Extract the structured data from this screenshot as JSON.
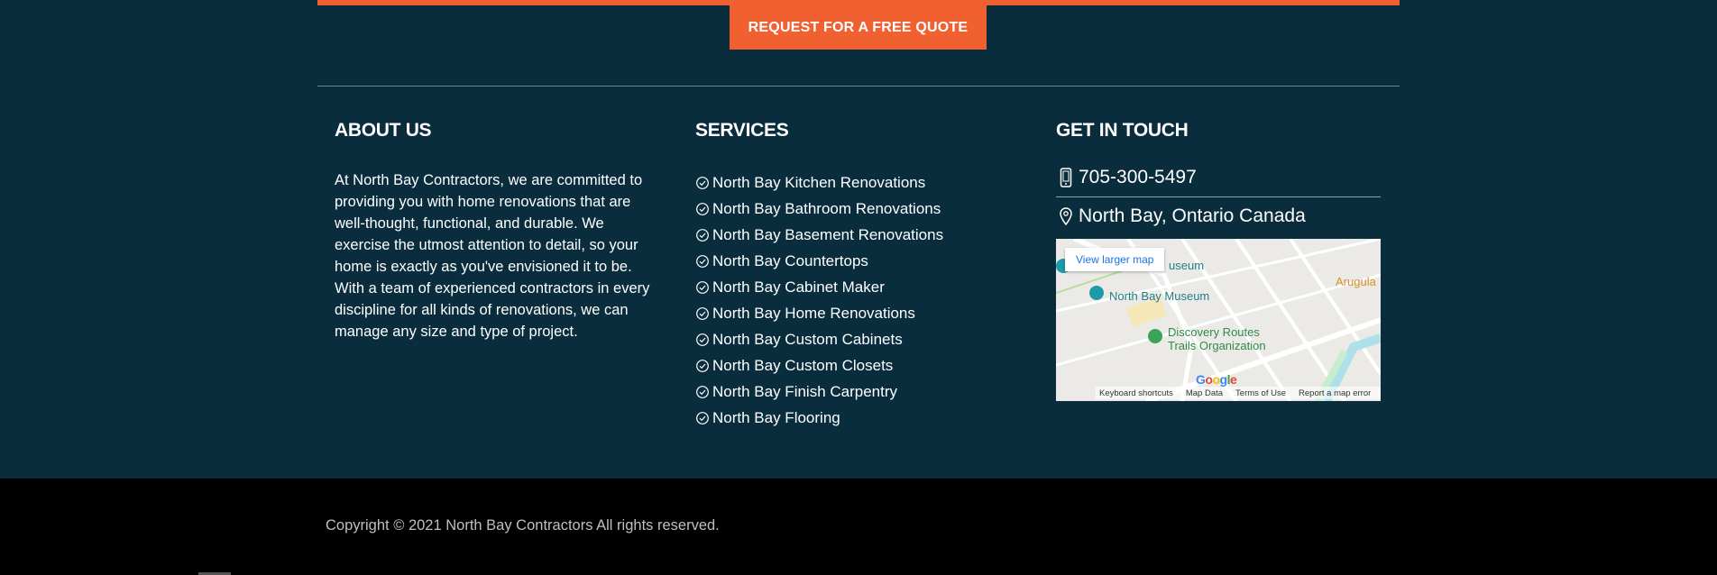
{
  "cta": {
    "quote_label": "REQUEST FOR A FREE QUOTE"
  },
  "about": {
    "title": "ABOUT US",
    "text": "At North Bay Contractors, we are committed to providing you with home renovations that are well-thought, functional, and durable. We exercise the utmost attention to detail, so your home is exactly as you've envisioned it to be. With a team of experienced contractors in every discipline for all kinds of renovations, we can manage any size and type of project."
  },
  "services": {
    "title": "SERVICES",
    "items": [
      "North Bay Kitchen Renovations",
      "North Bay Bathroom Renovations",
      "North Bay Basement Renovations",
      "North Bay Countertops",
      "North Bay Cabinet Maker",
      "North Bay Home Renovations",
      "North Bay Custom Cabinets",
      "North Bay Custom Closets",
      "North Bay Finish Carpentry",
      "North Bay Flooring"
    ]
  },
  "contact": {
    "title": "GET IN TOUCH",
    "phone": "705-300-5497",
    "location": "North Bay, Ontario Canada"
  },
  "map": {
    "view_larger": "View larger map",
    "labels": {
      "museum_partial": "useum",
      "museum": "North Bay Museum",
      "discovery_1": "Discovery Routes",
      "discovery_2": "Trails Organization",
      "arugula": "Arugula"
    },
    "google": "Google",
    "footer": [
      "Keyboard shortcuts",
      "Map Data",
      "Terms of Use",
      "Report a map error"
    ]
  },
  "footer": {
    "copyright": "Copyright © 2021 North Bay Contractors All rights reserved."
  },
  "colors": {
    "accent": "#f06030",
    "background": "#0a2d3e",
    "footer_bg": "#000000"
  }
}
